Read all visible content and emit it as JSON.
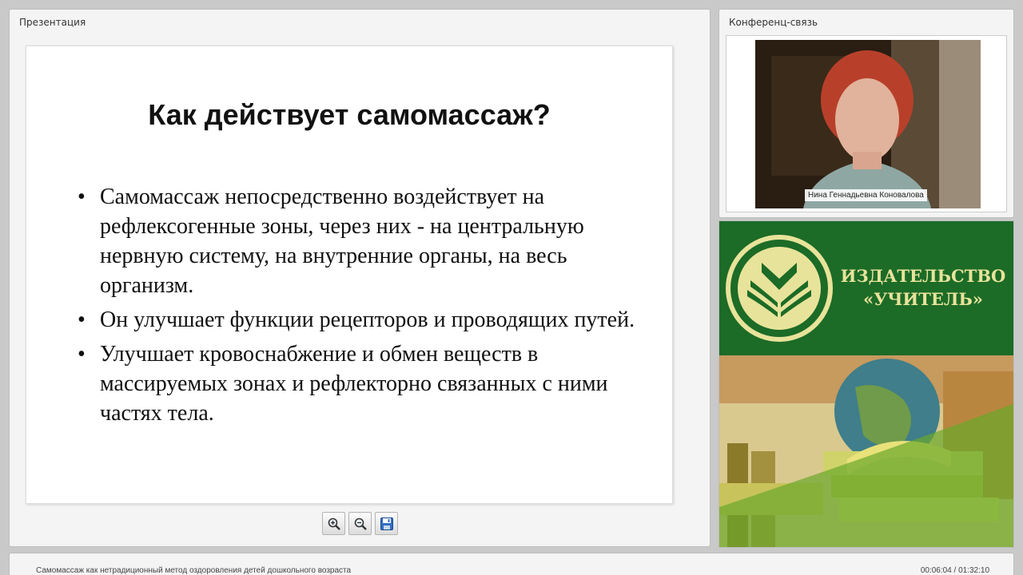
{
  "presentation": {
    "panel_title": "Презентация",
    "slide": {
      "title": "Как действует самомассаж?",
      "bullets": [
        "Самомассаж непосредственно воздействует на рефлексогенные зоны, через них - на центральную нервную систему, на внутренние органы, на весь организм.",
        "Он улучшает функции рецепторов и проводящих путей.",
        "Улучшает кровоснабжение и обмен веществ в массируемых зонах и рефлекторно связанных с ними частях тела."
      ]
    },
    "toolbar": [
      {
        "icon": "zoom-in-icon"
      },
      {
        "icon": "zoom-out-icon"
      },
      {
        "icon": "save-icon"
      }
    ]
  },
  "conference": {
    "panel_title": "Конференц-связь",
    "participant_name": "Нина Геннадьевна Коновалова"
  },
  "banner": {
    "publisher_line1": "ИЗДАТЕЛЬСТВО",
    "publisher_line2": "«УЧИТЕЛЬ»",
    "colors": {
      "green": "#1c6b27",
      "gold": "#e8e39a"
    }
  },
  "footer": {
    "webinar_title": "Самомассаж как нетрадиционный метод оздоровления детей дошкольного возраста",
    "time": "00:06:04 / 01:32:10"
  }
}
